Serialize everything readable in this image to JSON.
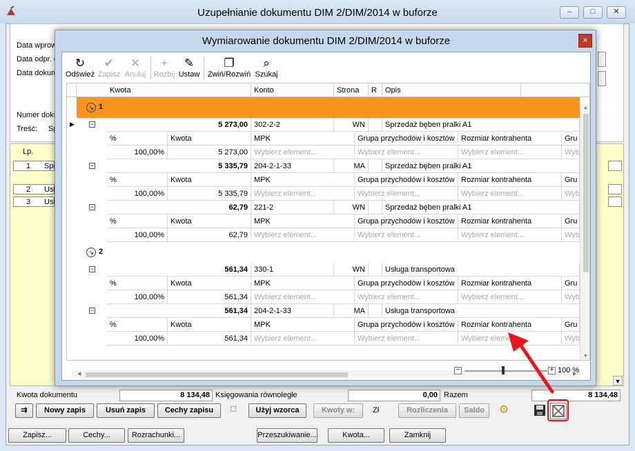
{
  "outer": {
    "title": "Uzupełnianie dokumentu DIM 2/DIM/2014 w buforze",
    "labels": {
      "data_wprow": "Data wprow",
      "data_odpr": "Data odpr. c",
      "data_dokum": "Data dokum",
      "numer_doku": "Numer doku",
      "tresc": "Treść:",
      "tresc_value": "Sp"
    },
    "list": {
      "header_lp": "Lp.",
      "rows": [
        {
          "lp": "1",
          "text": "Spr"
        },
        {
          "lp": "2",
          "text": "Usł"
        },
        {
          "lp": "3",
          "text": "Usł"
        }
      ]
    },
    "summary": {
      "kwota_label": "Kwota dokumentu",
      "kwota_value": "8 134,48",
      "ksiegowania_label": "Księgowania równoległe",
      "ksiegowania_value": "0,00",
      "razem_label": "Razem",
      "razem_value": "8 134,48"
    },
    "actions": {
      "nowy_zapis": "Nowy zapis",
      "usun_zapis": "Usuń zapis",
      "cechy_zapisu": "Cechy zapisu",
      "uzyj_wzorca": "Użyj wzorca",
      "kwoty_w": "Kwoty w:",
      "currency": "Zł",
      "rozliczenia": "Rozliczenia",
      "saldo": "Saldo"
    },
    "bottom": {
      "zapisz": "Zapisz...",
      "cechy": "Cechy...",
      "rozrachunki": "Rozrachunki...",
      "przeszukiwanie": "Przeszukiwanie...",
      "kwota": "Kwota...",
      "zamknij": "Zamknij"
    }
  },
  "dialog": {
    "title": "Wymiarowanie dokumentu DIM 2/DIM/2014 w buforze",
    "toolbar": {
      "odswiez": "Odśwież",
      "zapisz": "Zapisz",
      "anuluj": "Anuluj",
      "rozbij": "Rozbij",
      "ustaw": "Ustaw",
      "zwin_rozwin": "Zwiń/Rozwiń",
      "szukaj": "Szukaj"
    },
    "columns": {
      "kwota": "Kwota",
      "konto": "Konto",
      "strona": "Strona",
      "r": "R",
      "opis": "Opis"
    },
    "sub_columns": {
      "percent": "%",
      "kwota": "Kwota",
      "mpk": "MPK",
      "grupa": "Grupa przychodów i kosztów",
      "rozmiar": "Rozmiar kontrahenta",
      "gru": "Gru"
    },
    "placeholder": "Wybierz element...",
    "placeholder_short": "Wyb",
    "groups": [
      {
        "label": "1",
        "entries": [
          {
            "kwota": "5 273,00",
            "konto": "302-2-2",
            "strona": "WN",
            "opis": "Sprzedaż bęben pralki A1",
            "percent": "100,00%",
            "sub_kwota": "5 273,00"
          },
          {
            "kwota": "5 335,79",
            "konto": "204-2-1-33",
            "strona": "MA",
            "opis": "Sprzedaż bęben pralki A1",
            "percent": "100,00%",
            "sub_kwota": "5 335,79"
          },
          {
            "kwota": "62,79",
            "konto": "221-2",
            "strona": "WN",
            "opis": "Sprzedaż bęben pralki A1",
            "percent": "100,00%",
            "sub_kwota": "62,79"
          }
        ]
      },
      {
        "label": "2",
        "entries": [
          {
            "kwota": "561,34",
            "konto": "330-1",
            "strona": "WN",
            "opis": "Usługa transportowa",
            "percent": "100,00%",
            "sub_kwota": "561,34"
          },
          {
            "kwota": "561,34",
            "konto": "204-2-1-33",
            "strona": "MA",
            "opis": "Usługa transportowa",
            "percent": "100,00%",
            "sub_kwota": "561,34"
          }
        ]
      }
    ],
    "zoom": "100 %"
  },
  "colors": {
    "group_highlight": "#f7941d",
    "annotation": "#e8141b"
  }
}
